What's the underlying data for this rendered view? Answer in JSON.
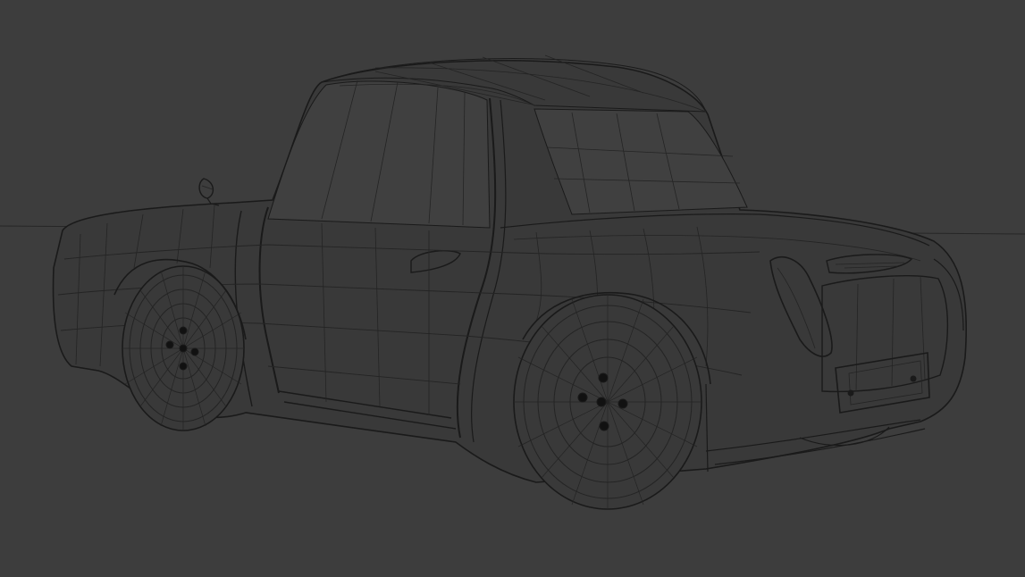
{
  "viewport": {
    "background": "#3d3d3d",
    "wire_color": "#1a1a1a",
    "body_color": "#393939",
    "glass_color": "#404040",
    "icon": "wireframe-car-model"
  }
}
